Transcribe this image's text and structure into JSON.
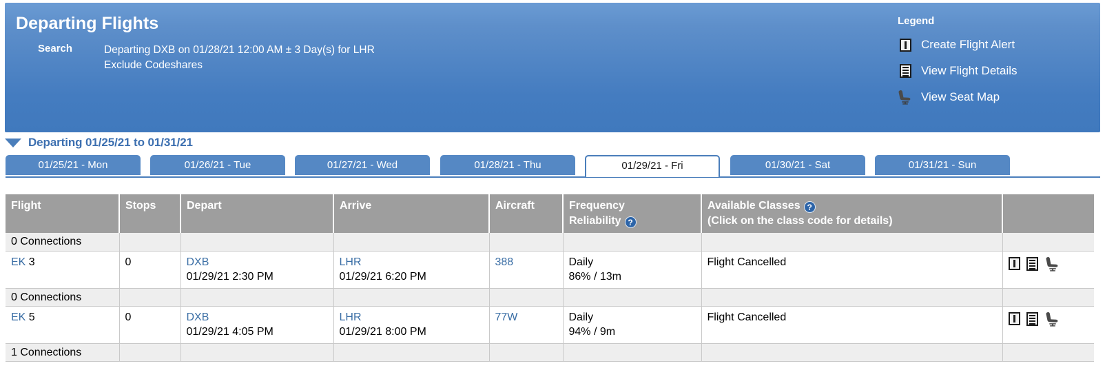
{
  "header": {
    "title": "Departing Flights",
    "search_label": "Search",
    "search_line1": "Departing DXB on 01/28/21 12:00 AM ± 3 Day(s) for LHR",
    "search_line2": "Exclude Codeshares",
    "bg_color": "#4a7ebb"
  },
  "legend": {
    "title": "Legend",
    "items": [
      {
        "icon": "alert-icon",
        "label": "Create Flight Alert"
      },
      {
        "icon": "details-icon",
        "label": "View Flight Details"
      },
      {
        "icon": "seat-icon",
        "label": "View Seat Map"
      }
    ]
  },
  "range": {
    "toggle_icon": "triangle-down-icon",
    "label": "Departing 01/25/21 to 01/31/21"
  },
  "tabs": [
    {
      "label": "01/25/21 - Mon",
      "active": false
    },
    {
      "label": "01/26/21 - Tue",
      "active": false
    },
    {
      "label": "01/27/21 - Wed",
      "active": false
    },
    {
      "label": "01/28/21 - Thu",
      "active": false
    },
    {
      "label": "01/29/21 - Fri",
      "active": true
    },
    {
      "label": "01/30/21 - Sat",
      "active": false
    },
    {
      "label": "01/31/21 - Sun",
      "active": false
    }
  ],
  "table": {
    "headers": {
      "flight": "Flight",
      "stops": "Stops",
      "depart": "Depart",
      "arrive": "Arrive",
      "aircraft": "Aircraft",
      "frequency_line1": "Frequency",
      "frequency_line2": "Reliability",
      "classes_line1": "Available Classes",
      "classes_line2": "(Click on the class code for details)",
      "help_glyph": "?"
    },
    "groups": [
      {
        "connections_label": "0 Connections",
        "flight": {
          "carrier": "EK",
          "number": "3",
          "stops": "0",
          "depart_code": "DXB",
          "depart_time": "01/29/21 2:30 PM",
          "arrive_code": "LHR",
          "arrive_time": "01/29/21 6:20 PM",
          "aircraft": "388",
          "frequency": "Daily",
          "reliability": "86% / 13m",
          "classes": "Flight Cancelled"
        }
      },
      {
        "connections_label": "0 Connections",
        "flight": {
          "carrier": "EK",
          "number": "5",
          "stops": "0",
          "depart_code": "DXB",
          "depart_time": "01/29/21 4:05 PM",
          "arrive_code": "LHR",
          "arrive_time": "01/29/21 8:00 PM",
          "aircraft": "77W",
          "frequency": "Daily",
          "reliability": "94% / 9m",
          "classes": "Flight Cancelled"
        }
      },
      {
        "connections_label": "1 Connections",
        "flight": null
      }
    ]
  }
}
